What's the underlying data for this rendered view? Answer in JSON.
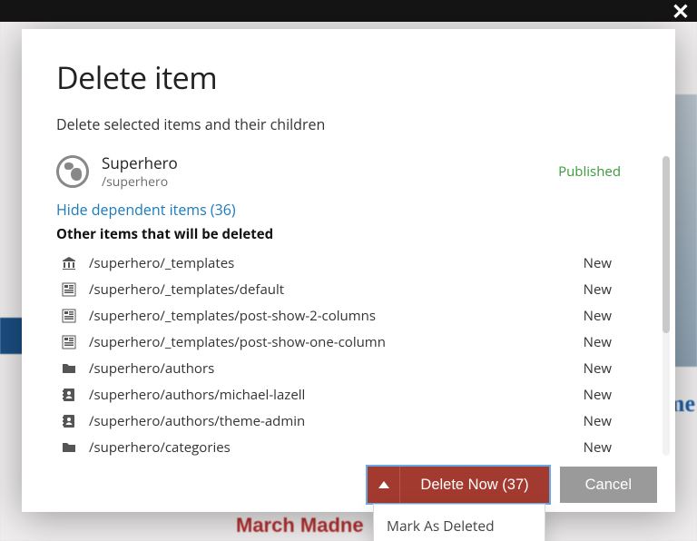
{
  "dialog": {
    "title": "Delete item",
    "subtitle": "Delete selected items and their children",
    "item": {
      "name": "Superhero",
      "path": "/superhero",
      "status": "Published"
    },
    "dependent_link": "Hide dependent items (36)",
    "section_label": "Other items that will be deleted",
    "rows": [
      {
        "icon": "bank",
        "path": "/superhero/_templates",
        "state": "New"
      },
      {
        "icon": "template",
        "path": "/superhero/_templates/default",
        "state": "New"
      },
      {
        "icon": "template",
        "path": "/superhero/_templates/post-show-2-columns",
        "state": "New"
      },
      {
        "icon": "template",
        "path": "/superhero/_templates/post-show-one-column",
        "state": "New"
      },
      {
        "icon": "folder",
        "path": "/superhero/authors",
        "state": "New"
      },
      {
        "icon": "contact",
        "path": "/superhero/authors/michael-lazell",
        "state": "New"
      },
      {
        "icon": "contact",
        "path": "/superhero/authors/theme-admin",
        "state": "New"
      },
      {
        "icon": "folder",
        "path": "/superhero/categories",
        "state": "New"
      }
    ],
    "buttons": {
      "delete_now": "Delete Now (37)",
      "cancel": "Cancel",
      "dropdown_option": "Mark As Deleted"
    }
  },
  "background": {
    "snippet_right": "me",
    "snippet_bottom": "March Madne"
  }
}
